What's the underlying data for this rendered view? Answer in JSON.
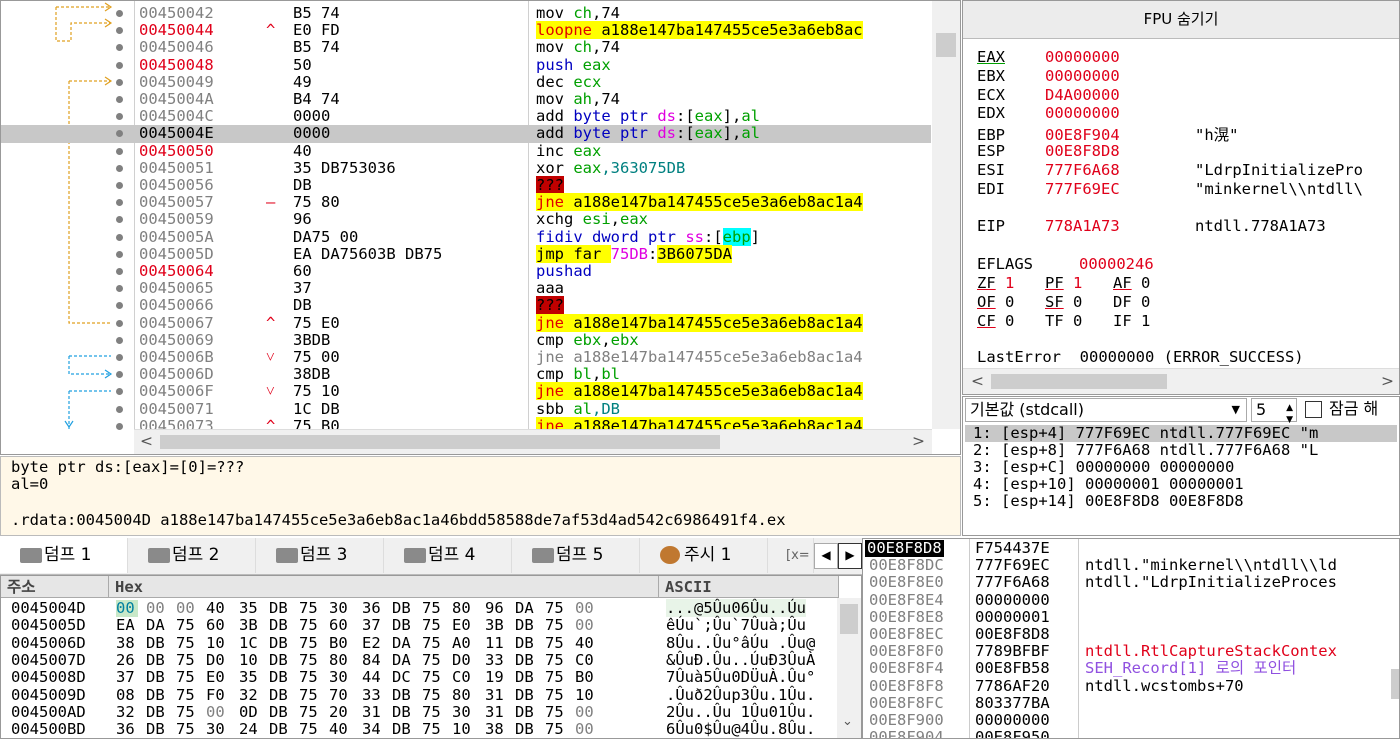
{
  "disasm": {
    "rows": [
      {
        "addr": "00450042",
        "addr_red": false,
        "arrow": "",
        "bytes": "B5 74",
        "asm": [
          [
            "mov ",
            "#000",
            ""
          ],
          [
            "ch",
            "#00a000",
            ""
          ],
          [
            ",74",
            "#000",
            ""
          ]
        ]
      },
      {
        "addr": "00450044",
        "addr_red": true,
        "arrow": "^",
        "bytes": "E0 FD",
        "asm": [
          [
            "loopne ",
            "#e00000",
            "y"
          ],
          [
            "a188e147ba147455ce5e3a6eb8ac",
            "#000",
            "y"
          ]
        ]
      },
      {
        "addr": "00450046",
        "addr_red": false,
        "arrow": "",
        "bytes": "B5 74",
        "asm": [
          [
            "mov ",
            "#000",
            ""
          ],
          [
            "ch",
            "#00a000",
            ""
          ],
          [
            ",74",
            "#000",
            ""
          ]
        ]
      },
      {
        "addr": "00450048",
        "addr_red": true,
        "arrow": "",
        "bytes": "50",
        "asm": [
          [
            "push ",
            "#0000c0",
            ""
          ],
          [
            "eax",
            "#00a000",
            ""
          ]
        ]
      },
      {
        "addr": "00450049",
        "addr_red": false,
        "arrow": "",
        "bytes": "49",
        "asm": [
          [
            "dec ",
            "#000",
            ""
          ],
          [
            "ecx",
            "#00a000",
            ""
          ]
        ]
      },
      {
        "addr": "0045004A",
        "addr_red": false,
        "arrow": "",
        "bytes": "B4 74",
        "asm": [
          [
            "mov ",
            "#000",
            ""
          ],
          [
            "ah",
            "#00a000",
            ""
          ],
          [
            ",74",
            "#000",
            ""
          ]
        ]
      },
      {
        "addr": "0045004C",
        "addr_red": false,
        "arrow": "",
        "bytes": "0000",
        "asm": [
          [
            "add ",
            "#000",
            ""
          ],
          [
            "byte ptr ",
            "#0000c0",
            ""
          ],
          [
            "ds",
            "#e000e0",
            ""
          ],
          [
            ":[",
            "#000",
            ""
          ],
          [
            "eax",
            "#00a000",
            ""
          ],
          [
            "],",
            "#000",
            ""
          ],
          [
            "al",
            "#00a000",
            ""
          ]
        ]
      },
      {
        "addr": "0045004E",
        "addr_red": false,
        "sel": true,
        "arrow": "",
        "bytes": "0000",
        "asm": [
          [
            "add ",
            "#000",
            ""
          ],
          [
            "byte ptr ",
            "#0000c0",
            ""
          ],
          [
            "ds",
            "#e000e0",
            ""
          ],
          [
            ":[",
            "#000",
            ""
          ],
          [
            "eax",
            "#00a000",
            ""
          ],
          [
            "],",
            "#000",
            ""
          ],
          [
            "al",
            "#00a000",
            ""
          ]
        ]
      },
      {
        "addr": "00450050",
        "addr_red": true,
        "arrow": "",
        "bytes": "40",
        "asm": [
          [
            "inc ",
            "#000",
            ""
          ],
          [
            "eax",
            "#00a000",
            ""
          ]
        ]
      },
      {
        "addr": "00450051",
        "addr_red": false,
        "arrow": "",
        "bytes": "35 DB753036",
        "asm": [
          [
            "xor ",
            "#000",
            ""
          ],
          [
            "eax",
            "#00a000",
            ""
          ],
          [
            ",363075DB",
            "#008080",
            ""
          ]
        ]
      },
      {
        "addr": "00450056",
        "addr_red": false,
        "arrow": "",
        "bytes": "DB",
        "asm": [
          [
            "???",
            "#000",
            "q"
          ]
        ]
      },
      {
        "addr": "00450057",
        "addr_red": false,
        "arrow": "-",
        "bytes": "75 80",
        "asm": [
          [
            "jne ",
            "#e00000",
            "y"
          ],
          [
            "a188e147ba147455ce5e3a6eb8ac1a4",
            "#000",
            "y"
          ]
        ]
      },
      {
        "addr": "00450059",
        "addr_red": false,
        "arrow": "",
        "bytes": "96",
        "asm": [
          [
            "xchg ",
            "#000",
            ""
          ],
          [
            "esi",
            "#00a000",
            ""
          ],
          [
            ",",
            "#000",
            ""
          ],
          [
            "eax",
            "#00a000",
            ""
          ]
        ]
      },
      {
        "addr": "0045005A",
        "addr_red": false,
        "arrow": "",
        "bytes": "DA75 00",
        "asm": [
          [
            "fidiv dword ptr ",
            "#0000c0",
            ""
          ],
          [
            "ss",
            "#e000e0",
            ""
          ],
          [
            ":[",
            "#000",
            ""
          ],
          [
            "ebp",
            "#00a000",
            "c"
          ],
          [
            "]",
            "#000",
            ""
          ]
        ]
      },
      {
        "addr": "0045005D",
        "addr_red": false,
        "arrow": "",
        "bytes": "EA DA75603B DB75",
        "asm": [
          [
            "jmp far ",
            "#000",
            "y"
          ],
          [
            "75DB",
            "#e000e0",
            ""
          ],
          [
            ":",
            "#000",
            ""
          ],
          [
            "3B6075DA",
            "#000",
            "y"
          ]
        ]
      },
      {
        "addr": "00450064",
        "addr_red": true,
        "arrow": "",
        "bytes": "60",
        "asm": [
          [
            "pushad",
            "#0000c0",
            ""
          ]
        ]
      },
      {
        "addr": "00450065",
        "addr_red": false,
        "arrow": "",
        "bytes": "37",
        "asm": [
          [
            "aaa",
            "#000",
            ""
          ]
        ]
      },
      {
        "addr": "00450066",
        "addr_red": false,
        "arrow": "",
        "bytes": "DB",
        "asm": [
          [
            "???",
            "#000",
            "q"
          ]
        ]
      },
      {
        "addr": "00450067",
        "addr_red": false,
        "arrow": "^",
        "bytes": "75 E0",
        "asm": [
          [
            "jne ",
            "#e00000",
            "y"
          ],
          [
            "a188e147ba147455ce5e3a6eb8ac1a4",
            "#000",
            "y"
          ]
        ]
      },
      {
        "addr": "00450069",
        "addr_red": false,
        "arrow": "",
        "bytes": "3BDB",
        "asm": [
          [
            "cmp ",
            "#000",
            ""
          ],
          [
            "ebx",
            "#00a000",
            ""
          ],
          [
            ",",
            "#000",
            ""
          ],
          [
            "ebx",
            "#00a000",
            ""
          ]
        ]
      },
      {
        "addr": "0045006B",
        "addr_red": false,
        "arrow": "v",
        "bytes": "75 00",
        "asm": [
          [
            "jne a188e147ba147455ce5e3a6eb8ac1a4",
            "#808080",
            ""
          ]
        ]
      },
      {
        "addr": "0045006D",
        "addr_red": false,
        "arrow": "",
        "bytes": "38DB",
        "asm": [
          [
            "cmp ",
            "#000",
            ""
          ],
          [
            "bl",
            "#00a000",
            ""
          ],
          [
            ",",
            "#000",
            ""
          ],
          [
            "bl",
            "#00a000",
            ""
          ]
        ]
      },
      {
        "addr": "0045006F",
        "addr_red": false,
        "arrow": "v",
        "bytes": "75 10",
        "asm": [
          [
            "jne ",
            "#e00000",
            "y"
          ],
          [
            "a188e147ba147455ce5e3a6eb8ac1a4",
            "#000",
            "y"
          ]
        ]
      },
      {
        "addr": "00450071",
        "addr_red": false,
        "arrow": "",
        "bytes": "1C DB",
        "asm": [
          [
            "sbb ",
            "#000",
            ""
          ],
          [
            "al",
            "#00a000",
            ""
          ],
          [
            ",DB",
            "#008080",
            ""
          ]
        ]
      },
      {
        "addr": "00450073",
        "addr_red": false,
        "arrow": "^",
        "bytes": "75 B0",
        "asm": [
          [
            "jne ",
            "#e00000",
            "y"
          ],
          [
            "a188e147ba147455ce5e3a6eb8ac1a4",
            "#000",
            "y"
          ]
        ]
      }
    ]
  },
  "info": {
    "line1": "byte ptr ds:[eax]=[0]=???",
    "line2": "al=0",
    "line3": ".rdata:0045004D a188e147ba147455ce5e3a6eb8ac1a46bdd58588de7af53d4ad542c6986491f4.ex"
  },
  "regs": {
    "fpu_label": "FPU 숨기기",
    "rows": [
      {
        "name": "EAX",
        "val": "00000000",
        "note": ""
      },
      {
        "name": "EBX",
        "val": "00000000",
        "note": ""
      },
      {
        "name": "ECX",
        "val": "D4A00000",
        "note": ""
      },
      {
        "name": "EDX",
        "val": "00000000",
        "note": ""
      },
      {
        "name": "EBP",
        "val": "00E8F904",
        "note": "\"h滉\""
      },
      {
        "name": "ESP",
        "val": "00E8F8D8",
        "note": ""
      },
      {
        "name": "ESI",
        "val": "777F6A68",
        "note": "\"LdrpInitializePro"
      },
      {
        "name": "EDI",
        "val": "777F69EC",
        "note": "\"minkernel\\\\ntdll\\"
      }
    ],
    "eip": {
      "name": "EIP",
      "val": "778A1A73",
      "note": "ntdll.778A1A73"
    },
    "eflags": {
      "name": "EFLAGS",
      "val": "00000246"
    },
    "flags": [
      [
        [
          "ZF",
          "1",
          true
        ],
        [
          "PF",
          "1",
          true
        ],
        [
          "AF",
          "0",
          false
        ]
      ],
      [
        [
          "OF",
          "0",
          false
        ],
        [
          "SF",
          "0",
          false
        ],
        [
          "DF",
          "0",
          false
        ]
      ],
      [
        [
          "CF",
          "0",
          false
        ],
        [
          "TF",
          "0",
          false
        ],
        [
          "IF",
          "1",
          false
        ]
      ]
    ],
    "lasterror": "LastError  00000000 (ERROR_SUCCESS)"
  },
  "cc": {
    "convention": "기본값 (stdcall)",
    "count": "5",
    "lock_label": "잠금 해",
    "rows": [
      "1: [esp+4] 777F69EC ntdll.777F69EC \"m",
      "2: [esp+8] 777F6A68 ntdll.777F6A68 \"L",
      "3: [esp+C] 00000000 00000000",
      "4: [esp+10] 00000001 00000001",
      "5: [esp+14] 00E8F8D8 00E8F8D8"
    ]
  },
  "tabs": [
    "덤프 1",
    "덤프 2",
    "덤프 3",
    "덤프 4",
    "덤프 5",
    "주시 1",
    "[x="
  ],
  "dump": {
    "hdr_addr": "주소",
    "hdr_hex": "Hex",
    "hdr_ascii": "ASCII",
    "rows": [
      {
        "addr": "0045004D",
        "hex": [
          "00",
          "00",
          "00",
          "40",
          "35",
          "DB",
          "75",
          "30",
          "36",
          "DB",
          "75",
          "80",
          "96",
          "DA",
          "75",
          "00"
        ],
        "ascii": "...@5Ûu06Ûu..Úu"
      },
      {
        "addr": "0045005D",
        "hex": [
          "EA",
          "DA",
          "75",
          "60",
          "3B",
          "DB",
          "75",
          "60",
          "37",
          "DB",
          "75",
          "E0",
          "3B",
          "DB",
          "75",
          "00"
        ],
        "ascii": "êÚu`;Ûu`7Ûuà;Ûu"
      },
      {
        "addr": "0045006D",
        "hex": [
          "38",
          "DB",
          "75",
          "10",
          "1C",
          "DB",
          "75",
          "B0",
          "E2",
          "DA",
          "75",
          "A0",
          "11",
          "DB",
          "75",
          "40"
        ],
        "ascii": "8Ûu..Ûu°âÚu .Ûu@"
      },
      {
        "addr": "0045007D",
        "hex": [
          "26",
          "DB",
          "75",
          "D0",
          "10",
          "DB",
          "75",
          "80",
          "84",
          "DA",
          "75",
          "D0",
          "33",
          "DB",
          "75",
          "C0"
        ],
        "ascii": "&ÛuÐ.Ûu..ÚuÐ3ÛuÀ"
      },
      {
        "addr": "0045008D",
        "hex": [
          "37",
          "DB",
          "75",
          "E0",
          "35",
          "DB",
          "75",
          "30",
          "44",
          "DC",
          "75",
          "C0",
          "19",
          "DB",
          "75",
          "B0"
        ],
        "ascii": "7Ûuà5Ûu0DÜuÀ.Ûu°"
      },
      {
        "addr": "0045009D",
        "hex": [
          "08",
          "DB",
          "75",
          "F0",
          "32",
          "DB",
          "75",
          "70",
          "33",
          "DB",
          "75",
          "80",
          "31",
          "DB",
          "75",
          "10"
        ],
        "ascii": ".Ûuð2Ûup3Ûu.1Ûu."
      },
      {
        "addr": "004500AD",
        "hex": [
          "32",
          "DB",
          "75",
          "00",
          "0D",
          "DB",
          "75",
          "20",
          "31",
          "DB",
          "75",
          "30",
          "31",
          "DB",
          "75",
          "00"
        ],
        "ascii": "2Ûu..Ûu 1Ûu01Ûu."
      },
      {
        "addr": "004500BD",
        "hex": [
          "36",
          "DB",
          "75",
          "30",
          "24",
          "DB",
          "75",
          "40",
          "34",
          "DB",
          "75",
          "10",
          "38",
          "DB",
          "75",
          "00"
        ],
        "ascii": "6Ûu0$Ûu@4Ûu.8Ûu."
      }
    ]
  },
  "stack": {
    "rows": [
      {
        "addr": "00E8F8D8",
        "val": "F754437E",
        "comment": "",
        "sel": true,
        "cc": ""
      },
      {
        "addr": "00E8F8DC",
        "val": "777F69EC",
        "comment": "ntdll.\"minkernel\\\\ntdll\\\\ld",
        "cc": "#000"
      },
      {
        "addr": "00E8F8E0",
        "val": "777F6A68",
        "comment": "ntdll.\"LdrpInitializeProces",
        "cc": "#000"
      },
      {
        "addr": "00E8F8E4",
        "val": "00000000",
        "comment": "",
        "cc": ""
      },
      {
        "addr": "00E8F8E8",
        "val": "00000001",
        "comment": "",
        "cc": ""
      },
      {
        "addr": "00E8F8EC",
        "val": "00E8F8D8",
        "comment": "",
        "cc": ""
      },
      {
        "addr": "00E8F8F0",
        "val": "7789BFBF",
        "comment": "ntdll.RtlCaptureStackContex",
        "cc": "#e0001a"
      },
      {
        "addr": "00E8F8F4",
        "val": "00E8FB58",
        "comment": "SEH_Record[1] 로의 포인터",
        "cc": "#9050e0"
      },
      {
        "addr": "00E8F8F8",
        "val": "7786AF20",
        "comment": "ntdll.wcstombs+70",
        "cc": "#000"
      },
      {
        "addr": "00E8F8FC",
        "val": "803377BA",
        "comment": "",
        "cc": ""
      },
      {
        "addr": "00E8F900",
        "val": "00000000",
        "comment": "",
        "cc": ""
      },
      {
        "addr": "00E8F904",
        "val": "00E8F950",
        "comment": "",
        "cc": ""
      }
    ]
  }
}
